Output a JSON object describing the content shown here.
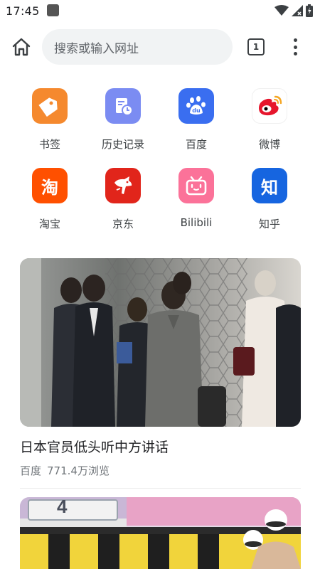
{
  "status_bar": {
    "time": "17:45"
  },
  "toolbar": {
    "address_placeholder": "搜索或输入网址",
    "tab_count": "1"
  },
  "shortcuts": [
    {
      "label": "书签",
      "icon": "bookmark-icon",
      "color": "#f5892e"
    },
    {
      "label": "历史记录",
      "icon": "history-icon",
      "color": "#7b8cf2"
    },
    {
      "label": "百度",
      "icon": "baidu-paw-icon",
      "color": "#3a6ef0"
    },
    {
      "label": "微博",
      "icon": "weibo-icon",
      "color": "#e6162d"
    },
    {
      "label": "淘宝",
      "icon": "taobao-icon",
      "color": "#ff5000",
      "glyph": "淘"
    },
    {
      "label": "京东",
      "icon": "jd-dog-icon",
      "color": "#e1251b"
    },
    {
      "label": "Bilibili",
      "icon": "bilibili-tv-icon",
      "color": "#fb7299"
    },
    {
      "label": "知乎",
      "icon": "zhihu-icon",
      "color": "#1665e0",
      "glyph": "知"
    }
  ],
  "feed": [
    {
      "title": "日本官员低头听中方讲话",
      "source": "百度",
      "views": "771.4万浏览"
    },
    {
      "badge_number": "4"
    }
  ]
}
